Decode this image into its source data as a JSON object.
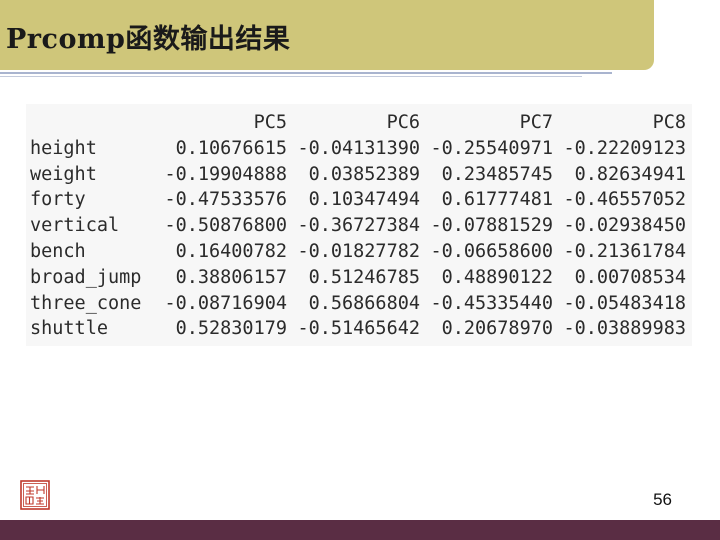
{
  "slide": {
    "title": "Prcomp函数输出结果",
    "page_number": "56"
  },
  "colors": {
    "title_bar": "#cfc67a",
    "bottom_bar": "#5a2d44",
    "seal": "#c0392b"
  },
  "table": {
    "columns": [
      "PC5",
      "PC6",
      "PC7",
      "PC8"
    ],
    "rows": [
      {
        "name": "height",
        "values": [
          "0.10676615",
          "-0.04131390",
          "-0.25540971",
          "-0.22209123"
        ]
      },
      {
        "name": "weight",
        "values": [
          "-0.19904888",
          "0.03852389",
          "0.23485745",
          "0.82634941"
        ]
      },
      {
        "name": "forty",
        "values": [
          "-0.47533576",
          "0.10347494",
          "0.61777481",
          "-0.46557052"
        ]
      },
      {
        "name": "vertical",
        "values": [
          "-0.50876800",
          "-0.36727384",
          "-0.07881529",
          "-0.02938450"
        ]
      },
      {
        "name": "bench",
        "values": [
          "0.16400782",
          "-0.01827782",
          "-0.06658600",
          "-0.21361784"
        ]
      },
      {
        "name": "broad_jump",
        "values": [
          "0.38806157",
          "0.51246785",
          "0.48890122",
          "0.00708534"
        ]
      },
      {
        "name": "three_cone",
        "values": [
          "-0.08716904",
          "0.56866804",
          "-0.45335440",
          "-0.05483418"
        ]
      },
      {
        "name": "shuttle",
        "values": [
          "0.52830179",
          "-0.51465642",
          "0.20678970",
          "-0.03889983"
        ]
      }
    ]
  }
}
